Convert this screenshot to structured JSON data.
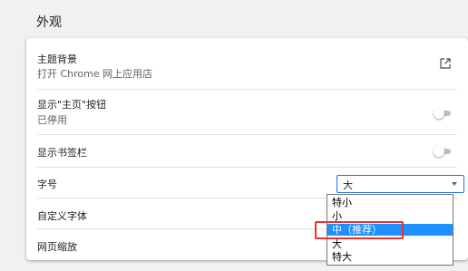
{
  "section_title": "外观",
  "settings": {
    "theme": {
      "label": "主题背景",
      "sublabel": "打开 Chrome 网上应用店",
      "icon": "external-link-icon"
    },
    "home_button": {
      "label": "显示\"主页\"按钮",
      "sublabel": "已停用",
      "toggle_on": false
    },
    "bookmarks_bar": {
      "label": "显示书签栏",
      "toggle_on": false
    },
    "font_size": {
      "label": "字号",
      "selected_value": "大"
    },
    "custom_fonts": {
      "label": "自定义字体"
    },
    "page_zoom": {
      "label": "网页缩放"
    }
  },
  "dropdown": {
    "options": [
      "特小",
      "小",
      "中（推荐）",
      "大",
      "特大"
    ],
    "highlighted_option": "中（推荐）"
  },
  "colors": {
    "accent": "#1a73e8",
    "dropdown_highlight": "#1e90ff",
    "annotation_box": "#e8322d"
  }
}
